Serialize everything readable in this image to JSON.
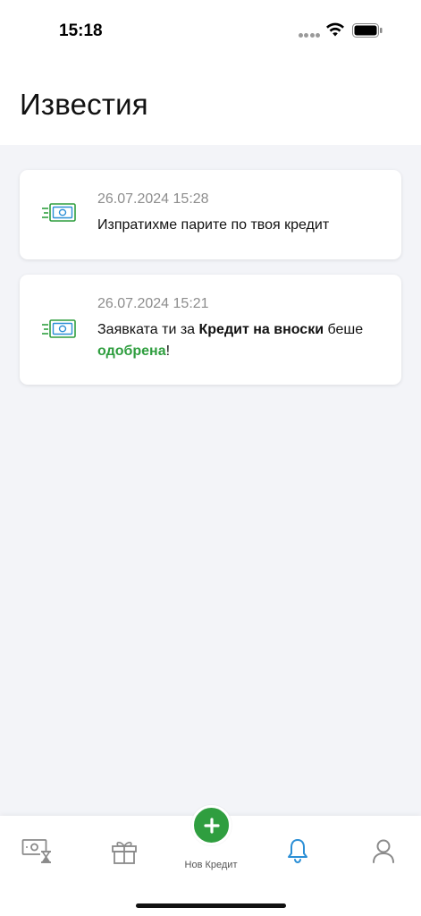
{
  "status_bar": {
    "time": "15:18"
  },
  "header": {
    "title": "Известия"
  },
  "notifications": [
    {
      "icon": "money-transfer-icon",
      "date": "26.07.2024 15:28",
      "text": "Изпратихме парите по твоя кредит"
    },
    {
      "icon": "money-transfer-icon",
      "date": "26.07.2024 15:21",
      "text_prefix": "Заявката ти за ",
      "text_bold": "Кредит на вноски",
      "text_middle": " беше ",
      "text_status": "одобрена",
      "text_suffix": "!"
    }
  ],
  "tabbar": {
    "new_credit_label": "Нов Кредит",
    "active_tab": "notifications"
  },
  "colors": {
    "accent_green": "#2f9e3f",
    "active_blue": "#2b8fd6",
    "icon_gray": "#8a8a8a"
  }
}
